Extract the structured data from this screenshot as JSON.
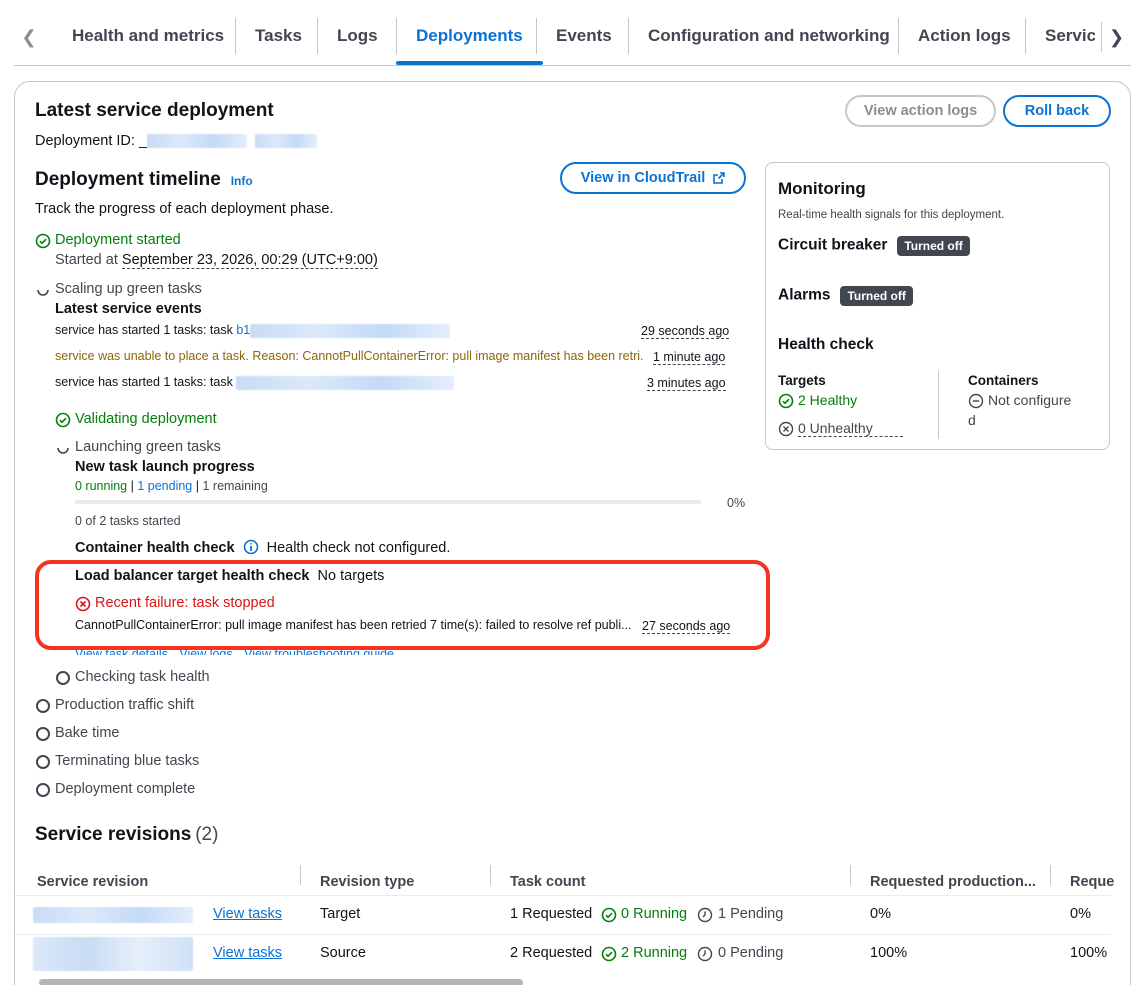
{
  "tabs": {
    "items": [
      "Health and metrics",
      "Tasks",
      "Logs",
      "Deployments",
      "Events",
      "Configuration and networking",
      "Action logs",
      "Service"
    ],
    "active": "Deployments"
  },
  "deployment": {
    "title": "Latest service deployment",
    "id_label": "Deployment ID:",
    "id_prefix": "_",
    "view_action_logs": "View action logs",
    "roll_back": "Roll back"
  },
  "timeline": {
    "title": "Deployment timeline",
    "info": "Info",
    "description": "Track the progress of each deployment phase.",
    "view_cloudtrail": "View in CloudTrail",
    "started": {
      "label": "Deployment started",
      "started_at_label": "Started at",
      "started_at": "September 23, 2026, 00:29 (UTC+9:00)"
    },
    "scaling": {
      "label": "Scaling up green tasks",
      "events_title": "Latest service events",
      "events": [
        {
          "text": "service has started 1 tasks: task",
          "link": "b1",
          "time": "29 seconds ago"
        },
        {
          "text": "service was unable to place a task. Reason: CannotPullContainerError: pull image manifest has been retri...",
          "time": "1 minute ago"
        },
        {
          "text": "service has started 1 tasks: task",
          "time": "3 minutes ago"
        }
      ]
    },
    "validating": {
      "label": "Validating deployment"
    },
    "launching": {
      "label": "Launching green tasks",
      "progress_title": "New task launch progress",
      "running": "0 running",
      "pending": "1 pending",
      "remaining": "1 remaining",
      "sep": "|",
      "percent": "0%",
      "progress_value": 0,
      "tasks_started": "0 of 2 tasks started",
      "container_health_label": "Container health check",
      "container_health_value": "Health check not configured.",
      "lb_health_label": "Load balancer target health check",
      "lb_health_value": "No targets",
      "failure_title": "Recent failure: task stopped",
      "failure_text": "CannotPullContainerError: pull image manifest has been retried 7 time(s): failed to resolve ref publi...",
      "failure_time": "27 seconds ago",
      "links": [
        "View task details",
        "View logs",
        "View troubleshooting guide"
      ]
    },
    "pending_steps": [
      "Checking task health",
      "Production traffic shift",
      "Bake time",
      "Terminating blue tasks",
      "Deployment complete"
    ]
  },
  "monitoring": {
    "title": "Monitoring",
    "description": "Real-time health signals for this deployment.",
    "circuit_breaker": "Circuit breaker",
    "circuit_badge": "Turned off",
    "alarms": "Alarms",
    "alarms_badge": "Turned off",
    "health_check": "Health check",
    "targets_label": "Targets",
    "healthy": "2 Healthy",
    "unhealthy": "0 Unhealthy",
    "containers_label": "Containers",
    "containers_value_1": "Not configure",
    "containers_value_2": "d"
  },
  "revisions": {
    "title": "Service revisions",
    "count": "(2)",
    "columns": [
      "Service revision",
      "Revision type",
      "Task count",
      "Requested production...",
      "Reque"
    ],
    "rows": [
      {
        "link": "View tasks",
        "type": "Target",
        "requested": "1 Requested",
        "running": "0 Running",
        "pending": "1 Pending",
        "prod": "0%",
        "req": "0%"
      },
      {
        "link": "View tasks",
        "type": "Source",
        "requested": "2 Requested",
        "running": "2 Running",
        "pending": "0 Pending",
        "prod": "100%",
        "req": "100%"
      }
    ]
  },
  "colors": {
    "accent": "#0972d3",
    "success": "#037f0c",
    "error": "#d91515",
    "warning": "#8d6605",
    "highlight": "#f53322"
  }
}
